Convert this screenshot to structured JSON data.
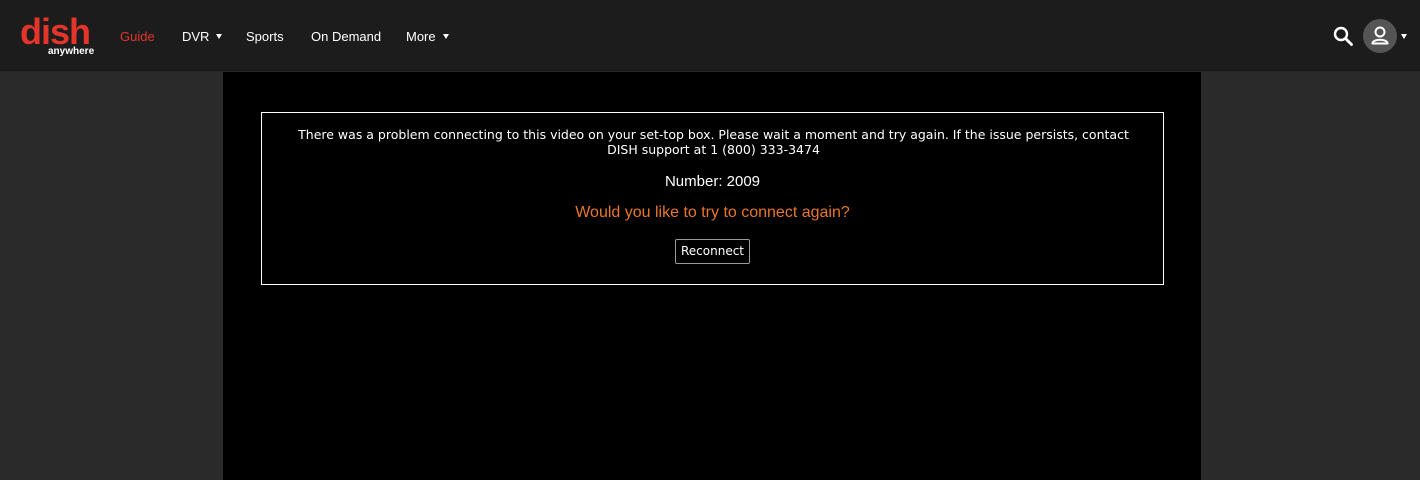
{
  "brand": {
    "logo_word": "dish",
    "logo_sub": "anywhere",
    "logo_color": "#e4352a"
  },
  "nav": {
    "items": [
      {
        "label": "Guide",
        "active": true,
        "has_dropdown": false
      },
      {
        "label": "DVR",
        "active": false,
        "has_dropdown": true
      },
      {
        "label": "Sports",
        "active": false,
        "has_dropdown": false
      },
      {
        "label": "On Demand",
        "active": false,
        "has_dropdown": false
      },
      {
        "label": "More",
        "active": false,
        "has_dropdown": true
      }
    ],
    "active_color": "#e4352a"
  },
  "header_actions": {
    "search_icon": "search-icon",
    "account_icon": "user-icon",
    "account_dropdown_icon": "caret-down-icon"
  },
  "error": {
    "message": "There was a problem connecting to this video on your set-top box. Please wait a moment and try again. If the issue persists, contact DISH support at 1 (800) 333-3474",
    "number_line": "Number: 2009",
    "question": "Would you like to try to connect again?",
    "question_color": "#e8762c",
    "button_label": "Reconnect"
  }
}
